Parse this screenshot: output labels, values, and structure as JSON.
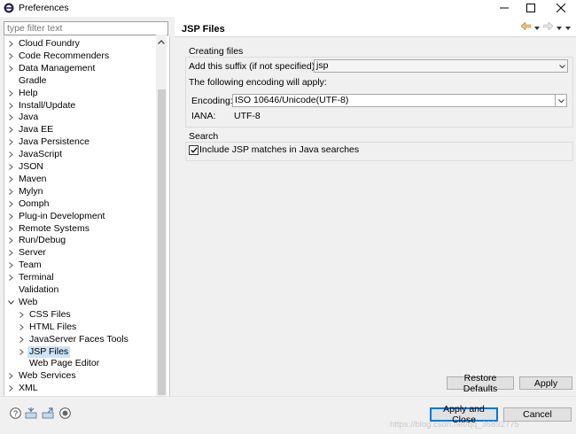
{
  "window": {
    "title": "Preferences"
  },
  "filter": {
    "placeholder": "type filter text"
  },
  "tree": {
    "items": [
      {
        "label": "Cloud Foundry",
        "expandable": true
      },
      {
        "label": "Code Recommenders",
        "expandable": true
      },
      {
        "label": "Data Management",
        "expandable": true
      },
      {
        "label": "Gradle",
        "expandable": false
      },
      {
        "label": "Help",
        "expandable": true
      },
      {
        "label": "Install/Update",
        "expandable": true
      },
      {
        "label": "Java",
        "expandable": true
      },
      {
        "label": "Java EE",
        "expandable": true
      },
      {
        "label": "Java Persistence",
        "expandable": true
      },
      {
        "label": "JavaScript",
        "expandable": true
      },
      {
        "label": "JSON",
        "expandable": true
      },
      {
        "label": "Maven",
        "expandable": true
      },
      {
        "label": "Mylyn",
        "expandable": true
      },
      {
        "label": "Oomph",
        "expandable": true
      },
      {
        "label": "Plug-in Development",
        "expandable": true
      },
      {
        "label": "Remote Systems",
        "expandable": true
      },
      {
        "label": "Run/Debug",
        "expandable": true
      },
      {
        "label": "Server",
        "expandable": true
      },
      {
        "label": "Team",
        "expandable": true
      },
      {
        "label": "Terminal",
        "expandable": true
      },
      {
        "label": "Validation",
        "expandable": false
      },
      {
        "label": "Web",
        "expandable": true,
        "expanded": true
      },
      {
        "label": "CSS Files",
        "expandable": true,
        "child": true
      },
      {
        "label": "HTML Files",
        "expandable": true,
        "child": true
      },
      {
        "label": "JavaServer Faces Tools",
        "expandable": true,
        "child": true
      },
      {
        "label": "JSP Files",
        "expandable": true,
        "child": true,
        "selected": true
      },
      {
        "label": "Web Page Editor",
        "expandable": false,
        "child": true
      },
      {
        "label": "Web Services",
        "expandable": true
      },
      {
        "label": "XML",
        "expandable": true
      }
    ]
  },
  "page": {
    "title": "JSP Files",
    "creating_files": {
      "group_label": "Creating files",
      "suffix_label": "Add this suffix (if not specified):",
      "suffix_value": "jsp",
      "encoding_note": "The following encoding will apply:",
      "encoding_label": "Encoding:",
      "encoding_value": "ISO 10646/Unicode(UTF-8)",
      "iana_label": "IANA:",
      "iana_value": "UTF-8"
    },
    "search": {
      "group_label": "Search",
      "checkbox_label": "Include JSP matches in Java searches",
      "checked": true
    },
    "restore_defaults_label": "Restore Defaults",
    "apply_label": "Apply"
  },
  "footer": {
    "apply_close_label": "Apply and Close",
    "cancel_label": "Cancel"
  },
  "watermark": "https://blog.csdn.net/qq_36892775",
  "colors": {
    "selection": "#cce4f7",
    "accent": "#0078d7"
  }
}
